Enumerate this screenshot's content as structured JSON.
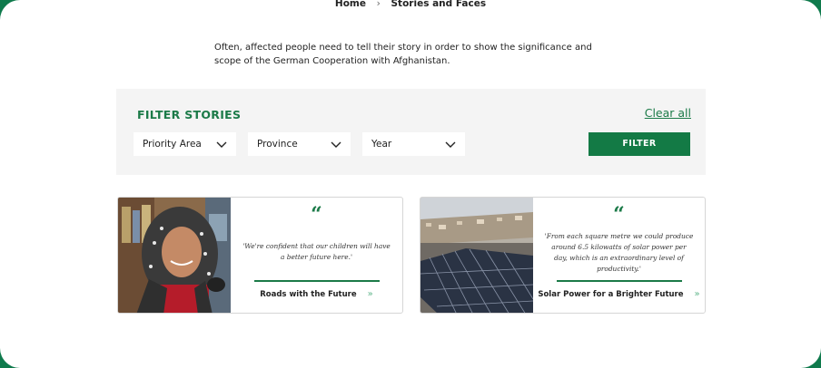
{
  "breadcrumb": {
    "home": "Home",
    "current": "Stories and Faces"
  },
  "intro": "Often, affected people need to tell their story in order to show the significance and scope of the German Cooperation with Afghanistan.",
  "filter": {
    "title": "FILTER STORIES",
    "clear_all": "Clear all",
    "priority_area": "Priority Area",
    "province": "Province",
    "year": "Year",
    "button": "FILTER"
  },
  "cards": [
    {
      "quote_mark": "“",
      "quote": "'We're confident that our children will have a better future here.'",
      "link": "Roads with the Future",
      "arrows": "»",
      "photo_icon": "woman-portrait-photo"
    },
    {
      "quote_mark": "“",
      "quote": "'From each square metre we could produce around 6.5 kilowatts of solar power per day, which is an extraordinary level of productivity.'",
      "link": "Solar Power for a Brighter Future",
      "arrows": "»",
      "photo_icon": "solar-panels-photo"
    }
  ],
  "colors": {
    "brand_green": "#1b7a48",
    "panel_bg": "#f4f4f4",
    "outer_bg": "#0f7a4c"
  }
}
